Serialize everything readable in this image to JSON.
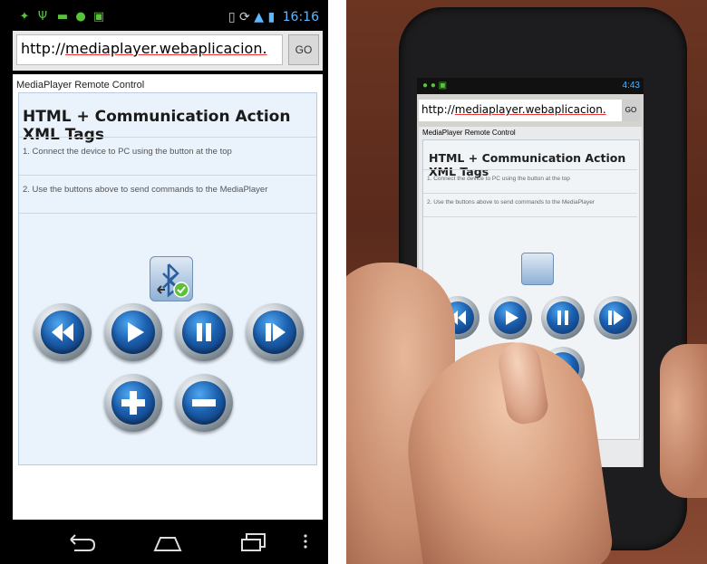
{
  "left": {
    "status": {
      "time": "16:16"
    },
    "address": {
      "url_prefix": "http://",
      "url_host": "mediaplayer.webaplicacion.",
      "go_label": "GO"
    },
    "page_title": "MediaPlayer Remote Control",
    "heading": "HTML + Communication Action XML Tags",
    "steps": [
      "1. Connect the device to PC using the button at the top",
      "2. Use the buttons above to send commands to the MediaPlayer"
    ]
  },
  "right": {
    "status": {
      "time": "4:43"
    },
    "address": {
      "url_prefix": "http://",
      "url_host": "mediaplayer.webaplicacion.",
      "go_label": "GO"
    },
    "page_title": "MediaPlayer Remote Control",
    "heading": "HTML + Communication Action XML Tags",
    "steps": [
      "1. Connect the device to PC using the button at the top",
      "2. Use the buttons above to send commands to the MediaPlayer"
    ]
  },
  "colors": {
    "button_blue": "#1b5fae",
    "link_underline": "#e33333",
    "status_green": "#59c33b",
    "status_blue": "#4fb3ff"
  }
}
